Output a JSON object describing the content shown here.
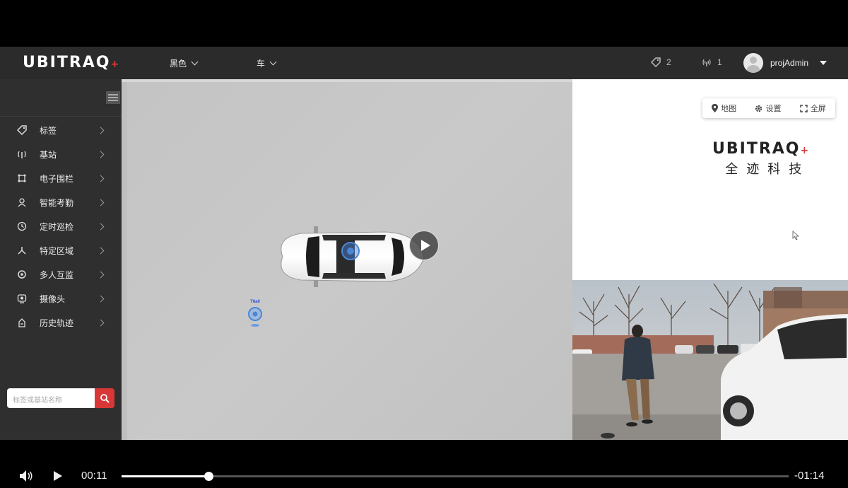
{
  "navbar": {
    "logo": "UBITRAQ",
    "dropdowns": [
      "黑色",
      "车"
    ],
    "stats": {
      "tags": "2",
      "stations": "1"
    },
    "user": "projAdmin"
  },
  "sidebar": {
    "items": [
      {
        "label": "标签",
        "icon": "tag-icon"
      },
      {
        "label": "基站",
        "icon": "antenna-icon"
      },
      {
        "label": "电子围栏",
        "icon": "fence-icon"
      },
      {
        "label": "智能考勤",
        "icon": "attendance-icon"
      },
      {
        "label": "定时巡检",
        "icon": "inspection-icon"
      },
      {
        "label": "特定区域",
        "icon": "area-icon"
      },
      {
        "label": "多人互监",
        "icon": "monitor-icon"
      },
      {
        "label": "摄像头",
        "icon": "camera-icon"
      },
      {
        "label": "历史轨迹",
        "icon": "history-icon"
      }
    ],
    "search_placeholder": "标签或基站名称"
  },
  "map": {
    "marker_label": "T6a0"
  },
  "right_panel": {
    "toolbar": {
      "map": "地图",
      "settings": "设置",
      "fullscreen": "全屏"
    },
    "brand_logo": "UBITRAQ",
    "brand_sub": "全迹科技"
  },
  "video": {
    "current_time": "00:11",
    "remaining_time": "-01:14",
    "progress": 0.13
  }
}
